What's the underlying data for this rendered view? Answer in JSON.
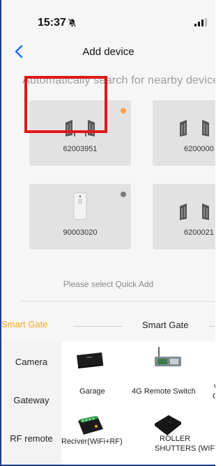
{
  "status_bar": {
    "time": "15:37"
  },
  "nav": {
    "title": "Add device"
  },
  "search_hint": "Automatically search for nearby device",
  "devices": [
    {
      "id": "62003951",
      "icon": "gate-icon",
      "dot": "orange",
      "dot_color": "#f5a24a"
    },
    {
      "id": "6200000",
      "icon": "gate-icon",
      "dot": "none"
    },
    {
      "id": "90003020",
      "icon": "remote-icon",
      "dot": "gray",
      "dot_color": "#7a7a7a"
    },
    {
      "id": "6200021",
      "icon": "gate-icon",
      "dot": "none"
    }
  ],
  "quick_add": {
    "label": "Please select Quick Add"
  },
  "categories": {
    "active": "Smart Gate",
    "section_title": "Smart Gate",
    "items": [
      "Camera",
      "Gateway",
      "RF remote"
    ]
  },
  "products": [
    {
      "label": "Garage",
      "icon": "garage-controller-icon"
    },
    {
      "label": "4G Remote Switch",
      "icon": "4g-remote-switch-icon"
    },
    {
      "label": "W",
      "icon": ""
    },
    {
      "label": "Co",
      "icon": ""
    },
    {
      "label": "Reciver(WiFi+RF)",
      "icon": "wifi-rf-receiver-icon"
    },
    {
      "label": "ROLLER",
      "icon": "roller-controller-icon"
    },
    {
      "label": "SHUTTERS (WIFI)",
      "icon": ""
    }
  ],
  "colors": {
    "accent": "#f5a623",
    "highlight": "#e01818",
    "card": "#e2e2e2",
    "back": "#1a73e8"
  }
}
